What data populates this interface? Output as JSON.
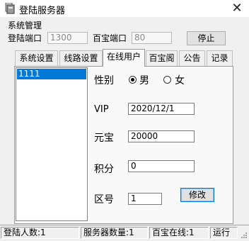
{
  "window": {
    "title": "登陆服务器",
    "close_glyph": "✕"
  },
  "menu": {
    "system_manage": "系统管理"
  },
  "toolbar": {
    "login_port_label": "登陆端口",
    "login_port_value": "1300",
    "shop_port_label": "百宝端口",
    "shop_port_value": "80",
    "stop_button": "停止"
  },
  "tabs": [
    {
      "label": "系统设置"
    },
    {
      "label": "线路设置"
    },
    {
      "label": "在线用户"
    },
    {
      "label": "百宝阁"
    },
    {
      "label": "公告"
    },
    {
      "label": "记录"
    }
  ],
  "active_tab": "在线用户",
  "users": [
    "1111"
  ],
  "form": {
    "gender_label": "性别",
    "gender_options": [
      {
        "label": "男",
        "selected": true
      },
      {
        "label": "女",
        "selected": false
      }
    ],
    "vip_label": "VIP",
    "vip_value": "2020/12/1",
    "yuanbao_label": "元宝",
    "yuanbao_value": "20000",
    "points_label": "积分",
    "points_value": "0",
    "zone_label": "区号",
    "zone_value": "1",
    "modify_button": "修改"
  },
  "status": [
    "登陆人数:1",
    "服务器数量:1",
    "百宝在线:1",
    "运行"
  ],
  "colors": {
    "selection": "#0078d7",
    "window_bg": "#f0f0f0"
  }
}
